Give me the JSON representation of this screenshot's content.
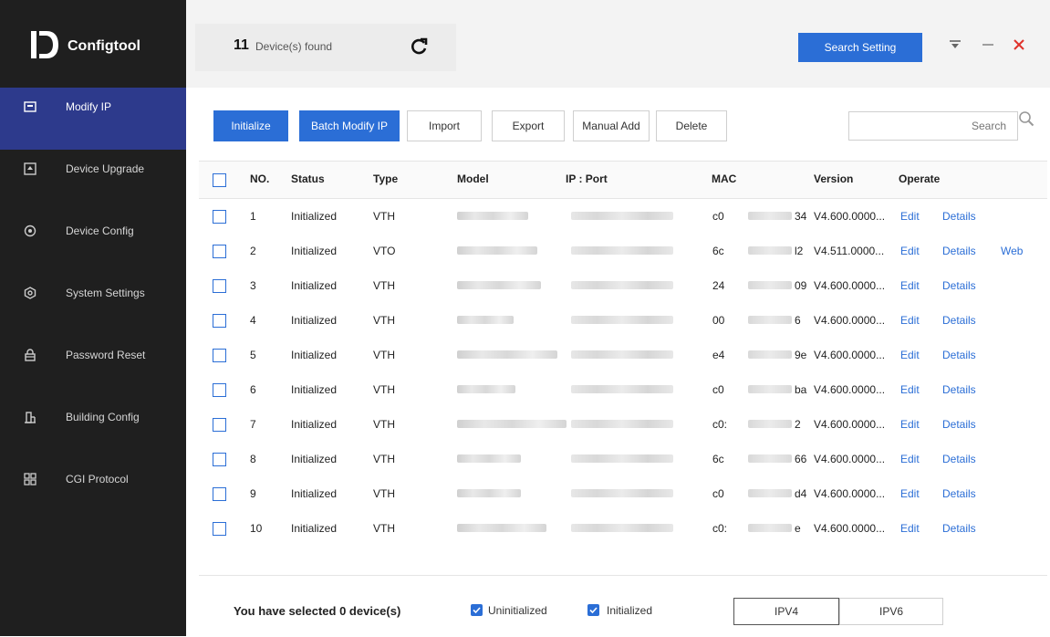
{
  "app": {
    "name": "Configtool"
  },
  "sidebar": {
    "items": [
      {
        "label": "Modify IP",
        "icon": "modify-ip-icon"
      },
      {
        "label": "Device Upgrade",
        "icon": "upgrade-icon"
      },
      {
        "label": "Device Config",
        "icon": "device-config-icon"
      },
      {
        "label": "System Settings",
        "icon": "system-settings-icon"
      },
      {
        "label": "Password Reset",
        "icon": "lock-icon"
      },
      {
        "label": "Building Config",
        "icon": "building-icon"
      },
      {
        "label": "CGI Protocol",
        "icon": "cgi-grid-icon"
      }
    ],
    "active_index": 0
  },
  "header": {
    "device_count": "11",
    "device_count_label": "Device(s) found",
    "search_setting_label": "Search Setting"
  },
  "toolbar": {
    "initialize": "Initialize",
    "batch_modify_ip": "Batch Modify IP",
    "import": "Import",
    "export": "Export",
    "manual_add": "Manual Add",
    "delete": "Delete",
    "search_placeholder": "Search"
  },
  "table": {
    "columns": [
      "NO.",
      "Status",
      "Type",
      "Model",
      "IP : Port",
      "MAC",
      "Version",
      "Operate"
    ],
    "rows": [
      {
        "no": "1",
        "status": "Initialized",
        "type": "VTH",
        "mac_start": "c0",
        "mac_end": "34",
        "version": "V4.600.0000...",
        "edit": "Edit",
        "details": "Details",
        "web": ""
      },
      {
        "no": "2",
        "status": "Initialized",
        "type": "VTO",
        "mac_start": "6c",
        "mac_end": "l2",
        "version": "V4.511.0000...",
        "edit": "Edit",
        "details": "Details",
        "web": "Web"
      },
      {
        "no": "3",
        "status": "Initialized",
        "type": "VTH",
        "mac_start": "24",
        "mac_end": "09",
        "version": "V4.600.0000...",
        "edit": "Edit",
        "details": "Details",
        "web": ""
      },
      {
        "no": "4",
        "status": "Initialized",
        "type": "VTH",
        "mac_start": "00",
        "mac_end": "6",
        "version": "V4.600.0000...",
        "edit": "Edit",
        "details": "Details",
        "web": ""
      },
      {
        "no": "5",
        "status": "Initialized",
        "type": "VTH",
        "mac_start": "e4",
        "mac_end": "9e",
        "version": "V4.600.0000...",
        "edit": "Edit",
        "details": "Details",
        "web": ""
      },
      {
        "no": "6",
        "status": "Initialized",
        "type": "VTH",
        "mac_start": "c0",
        "mac_end": "ba",
        "version": "V4.600.0000...",
        "edit": "Edit",
        "details": "Details",
        "web": ""
      },
      {
        "no": "7",
        "status": "Initialized",
        "type": "VTH",
        "mac_start": "c0:",
        "mac_end": "2",
        "version": "V4.600.0000...",
        "edit": "Edit",
        "details": "Details",
        "web": ""
      },
      {
        "no": "8",
        "status": "Initialized",
        "type": "VTH",
        "mac_start": "6c",
        "mac_end": "66",
        "version": "V4.600.0000...",
        "edit": "Edit",
        "details": "Details",
        "web": ""
      },
      {
        "no": "9",
        "status": "Initialized",
        "type": "VTH",
        "mac_start": "c0",
        "mac_end": "d4",
        "version": "V4.600.0000...",
        "edit": "Edit",
        "details": "Details",
        "web": ""
      },
      {
        "no": "10",
        "status": "Initialized",
        "type": "VTH",
        "mac_start": "c0:",
        "mac_end": "e",
        "version": "V4.600.0000...",
        "edit": "Edit",
        "details": "Details",
        "web": ""
      }
    ]
  },
  "footer": {
    "selected_text": "You have selected 0 device(s)",
    "uninitialized_label": "Uninitialized",
    "initialized_label": "Initialized",
    "ipv4_label": "IPV4",
    "ipv6_label": "IPV6"
  },
  "colors": {
    "accent": "#2b6ed6",
    "sidebar_bg": "#1f1f1f",
    "sidebar_active": "#2d3a8c",
    "close_red": "#e0322b"
  }
}
